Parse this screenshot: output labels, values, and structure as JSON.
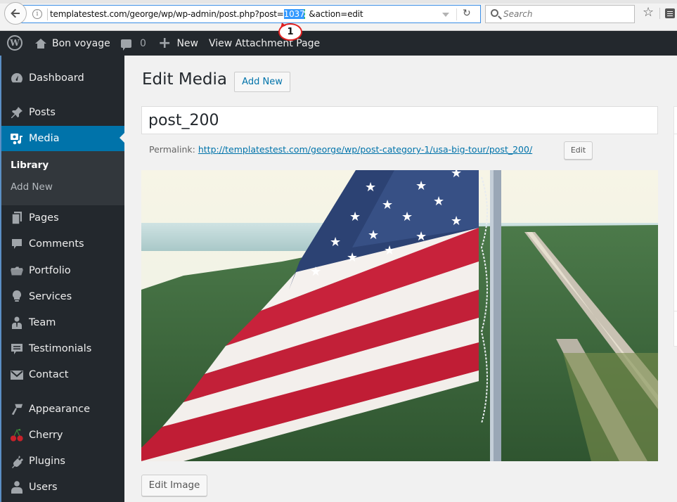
{
  "browser": {
    "url_prefix": "templatestest.com/george/wp/wp-admin/post.php?post=",
    "url_selected": "1037",
    "url_suffix": "&action=edit",
    "search_placeholder": "Search",
    "icons": [
      "back-arrow-icon",
      "info-icon",
      "dropdown-arrow-icon",
      "reload-icon",
      "search-icon",
      "bookmark-star-icon",
      "reader-view-icon"
    ]
  },
  "annotation": {
    "label": "1",
    "color": "#e02020"
  },
  "adminbar": {
    "site_name": "Bon voyage",
    "comments_count": "0",
    "new_label": "New",
    "view_attachment_label": "View Attachment Page"
  },
  "sidebar": {
    "items": [
      {
        "label": "Dashboard",
        "icon": "dashboard-icon"
      },
      {
        "label": "Posts",
        "icon": "pin-icon"
      },
      {
        "label": "Media",
        "icon": "media-icon",
        "current": true
      },
      {
        "label": "Pages",
        "icon": "pages-icon"
      },
      {
        "label": "Comments",
        "icon": "comments-icon"
      },
      {
        "label": "Portfolio",
        "icon": "folder-icon"
      },
      {
        "label": "Services",
        "icon": "lightbulb-icon"
      },
      {
        "label": "Team",
        "icon": "person-icon"
      },
      {
        "label": "Testimonials",
        "icon": "testimonial-icon"
      },
      {
        "label": "Contact",
        "icon": "envelope-icon"
      },
      {
        "label": "Appearance",
        "icon": "paintbrush-icon"
      },
      {
        "label": "Cherry",
        "icon": "cherry-icon"
      },
      {
        "label": "Plugins",
        "icon": "plug-icon"
      },
      {
        "label": "Users",
        "icon": "users-icon"
      }
    ],
    "submenu": [
      {
        "label": "Library",
        "active": true
      },
      {
        "label": "Add New"
      }
    ],
    "accent_color": "#0073aa"
  },
  "main": {
    "page_title": "Edit Media",
    "add_new_label": "Add New",
    "title_value": "post_200",
    "permalink_label": "Permalink:",
    "permalink_url_base": "http://templatestest.com/george/wp/post-category-1/usa-big-tour/",
    "permalink_slug": "post_200",
    "permalink_trailing": "/",
    "permalink_edit_label": "Edit",
    "image_alt": "Aerial photo of an American flag waving above a coastal tree-lined road",
    "edit_image_label": "Edit Image"
  }
}
